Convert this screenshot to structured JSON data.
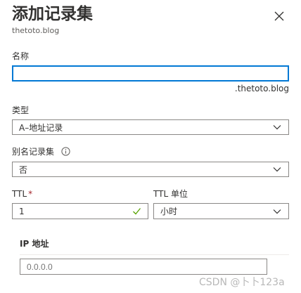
{
  "header": {
    "title": "添加记录集",
    "subtitle": "thetoto.blog",
    "close_icon": "close-icon"
  },
  "form": {
    "name": {
      "label": "名称",
      "value": "",
      "suffix": ".thetoto.blog"
    },
    "type": {
      "label": "类型",
      "value": "A–地址记录"
    },
    "alias": {
      "label": "别名记录集",
      "info_icon": "info-icon",
      "value": "否"
    },
    "ttl": {
      "label": "TTL",
      "required_mark": "*",
      "value": "1",
      "valid_icon": "checkmark-icon"
    },
    "ttl_unit": {
      "label": "TTL 单位",
      "value": "小时"
    },
    "ip_section": {
      "label": "IP 地址",
      "placeholder": "0.0.0.0"
    }
  },
  "watermark": "CSDN @卜卜123a",
  "colors": {
    "focus_border": "#0078d4",
    "required": "#a4262c",
    "valid_check": "#57a300",
    "border": "#8a8886"
  }
}
